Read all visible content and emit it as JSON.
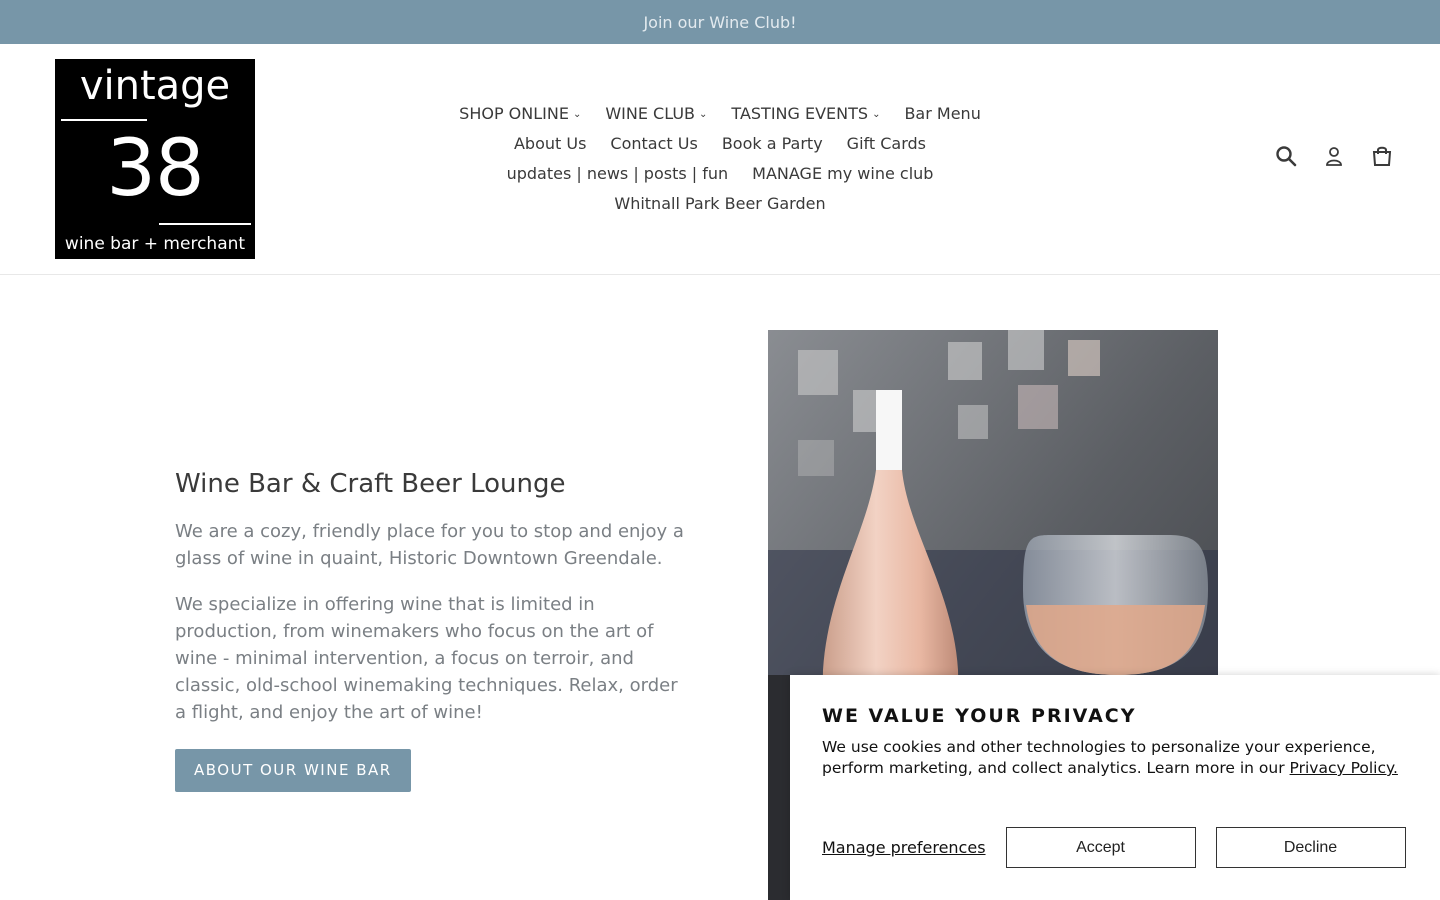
{
  "announcement": {
    "text": "Join our Wine Club!"
  },
  "logo": {
    "line1": "vintage",
    "line2": "38",
    "line3": "wine bar + merchant"
  },
  "nav": {
    "row1": [
      {
        "label": "SHOP ONLINE",
        "dropdown": true
      },
      {
        "label": "WINE CLUB",
        "dropdown": true
      },
      {
        "label": "TASTING EVENTS",
        "dropdown": true
      },
      {
        "label": "Bar Menu",
        "dropdown": false
      }
    ],
    "row2": [
      {
        "label": "About Us"
      },
      {
        "label": "Contact Us"
      },
      {
        "label": "Book a Party"
      },
      {
        "label": "Gift Cards"
      }
    ],
    "row3": [
      {
        "label": "updates | news | posts | fun"
      },
      {
        "label": "MANAGE my wine club"
      }
    ],
    "row4": [
      {
        "label": "Whitnall Park Beer Garden"
      }
    ],
    "chevron": "⌄"
  },
  "header_icons": [
    "search-icon",
    "account-icon",
    "cart-icon"
  ],
  "hero": {
    "title": "Wine Bar & Craft Beer Lounge",
    "p1": "We are a cozy, friendly place for you to stop and enjoy a glass of wine in quaint, Historic Downtown Greendale.",
    "p2": "We specialize in offering wine that is limited in production, from winemakers who focus on the art of wine - minimal intervention, a focus on terroir, and classic, old-school winemaking techniques. Relax, order a flight, and enjoy the art of wine!",
    "button": "ABOUT OUR WINE BAR"
  },
  "privacy": {
    "title": "WE VALUE YOUR PRIVACY",
    "body": "We use cookies and other technologies to personalize your experience, perform marketing, and collect analytics. Learn more in our ",
    "link": "Privacy Policy.",
    "manage": "Manage preferences",
    "accept": "Accept",
    "decline": "Decline"
  },
  "colors": {
    "accent": "#7796a8",
    "text": "#3a3a3a",
    "muted": "#7a7f84"
  }
}
